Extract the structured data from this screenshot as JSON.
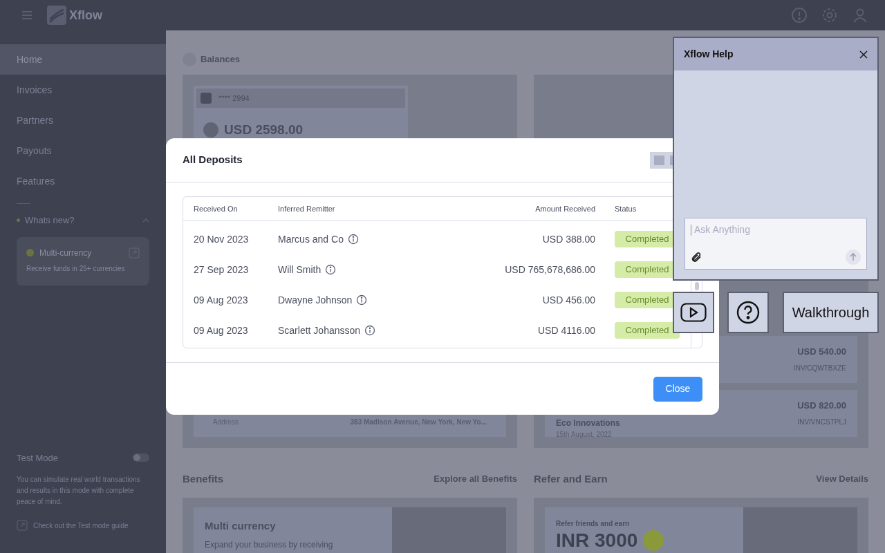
{
  "top_bar": {
    "brand": "Xflow"
  },
  "sidebar": {
    "items": [
      {
        "label": "Home",
        "selected": true
      },
      {
        "label": "Invoices",
        "selected": false
      },
      {
        "label": "Partners",
        "selected": false
      },
      {
        "label": "Payouts",
        "selected": false
      },
      {
        "label": "Features",
        "selected": false
      }
    ],
    "whats_new": {
      "label": "Whats new?",
      "expanded": true,
      "card": {
        "title": "Multi-currency",
        "text": "Receive funds in 25+ currencies"
      }
    },
    "test_mode": {
      "title": "Test Mode",
      "on": false,
      "text": "You can simulate real world transactions and results in this mode with complete peace of mind.",
      "link": "Check out the Test mode guide"
    }
  },
  "background": {
    "balances": {
      "title": "Balances",
      "account": "**** 2994",
      "amount": "USD 2598.00",
      "address_label": "Address",
      "address": "383 Madison Avenue, New York, New Yo..."
    },
    "invoices": [
      {
        "amount": "USD 540.00",
        "ref": "INV/CQWTBXZE"
      },
      {
        "name": "Eco Innovations",
        "date": "15th August, 2022",
        "amount": "USD 820.00",
        "ref": "INV/VNCSTPLJ"
      }
    ],
    "benefits": {
      "title": "Benefits",
      "link": "Explore all Benefits",
      "card_title": "Multi currency",
      "card_text": "Expand your business by receiving"
    },
    "refer": {
      "title": "Refer and Earn",
      "link": "View Details",
      "card_label": "Refer friends and earn",
      "card_amount": "INR 3000"
    }
  },
  "modal": {
    "title": "All Deposits",
    "columns": [
      "Received On",
      "Inferred Remitter",
      "Amount Received",
      "Status"
    ],
    "rows": [
      {
        "date": "20 Nov 2023",
        "remitter": "Marcus and Co",
        "amount": "USD 388.00",
        "status": "Completed"
      },
      {
        "date": "27 Sep 2023",
        "remitter": "Will Smith",
        "amount": "USD 765,678,686.00",
        "status": "Completed"
      },
      {
        "date": "09 Aug 2023",
        "remitter": "Dwayne Johnson",
        "amount": "USD 456.00",
        "status": "Completed"
      },
      {
        "date": "09 Aug 2023",
        "remitter": "Scarlett Johansson",
        "amount": "USD 4116.00",
        "status": "Completed"
      }
    ],
    "close": "Close"
  },
  "help": {
    "title": "Xflow Help",
    "placeholder": "Ask Anything",
    "walkthrough": "Walkthrough"
  }
}
